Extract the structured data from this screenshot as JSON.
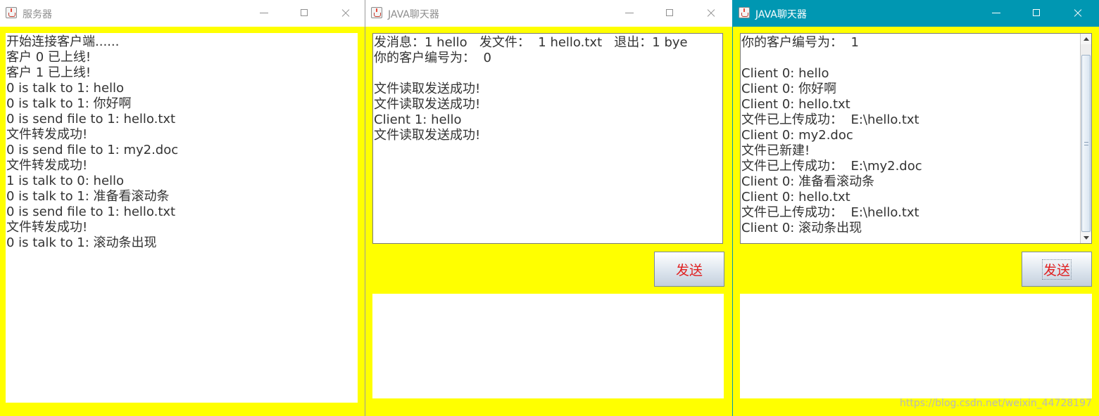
{
  "server": {
    "title": "服务器",
    "log": [
      "开始连接客户端......",
      "客户 0 已上线!",
      "客户 1 已上线!",
      "0 is talk to 1: hello",
      "0 is talk to 1: 你好啊",
      "0 is send file to 1: hello.txt",
      "文件转发成功!",
      "0 is send file to 1: my2.doc",
      "文件转发成功!",
      "1 is talk to 0: hello",
      "0 is talk to 1: 准备看滚动条",
      "0 is send file to 1: hello.txt",
      "文件转发成功!",
      "0 is talk to 1: 滚动条出现"
    ]
  },
  "client1": {
    "title": "JAVA聊天器",
    "messages": [
      "发消息：1 hello   发文件：  1 hello.txt   退出：1 bye",
      "你的客户编号为：  0",
      "",
      "文件读取发送成功!",
      "文件读取发送成功!",
      "Client 1: hello",
      "文件读取发送成功!"
    ],
    "send_label": "发送",
    "input_value": ""
  },
  "client2": {
    "title": "JAVA聊天器",
    "messages": [
      "你的客户编号为：  1",
      "",
      "Client 0: hello",
      "Client 0: 你好啊",
      "Client 0: hello.txt",
      "文件已上传成功：  E:\\hello.txt",
      "Client 0: my2.doc",
      "文件已新建!",
      "文件已上传成功：  E:\\my2.doc",
      "Client 0: 准备看滚动条",
      "Client 0: hello.txt",
      "文件已上传成功：  E:\\hello.txt",
      "Client 0: 滚动条出现"
    ],
    "send_label": "发送",
    "input_value": ""
  },
  "watermark": "https://blog.csdn.net/weixin_44728197",
  "colors": {
    "panel_background": "#ffff00",
    "active_titlebar": "#0097b2",
    "button_text": "#e02020"
  }
}
